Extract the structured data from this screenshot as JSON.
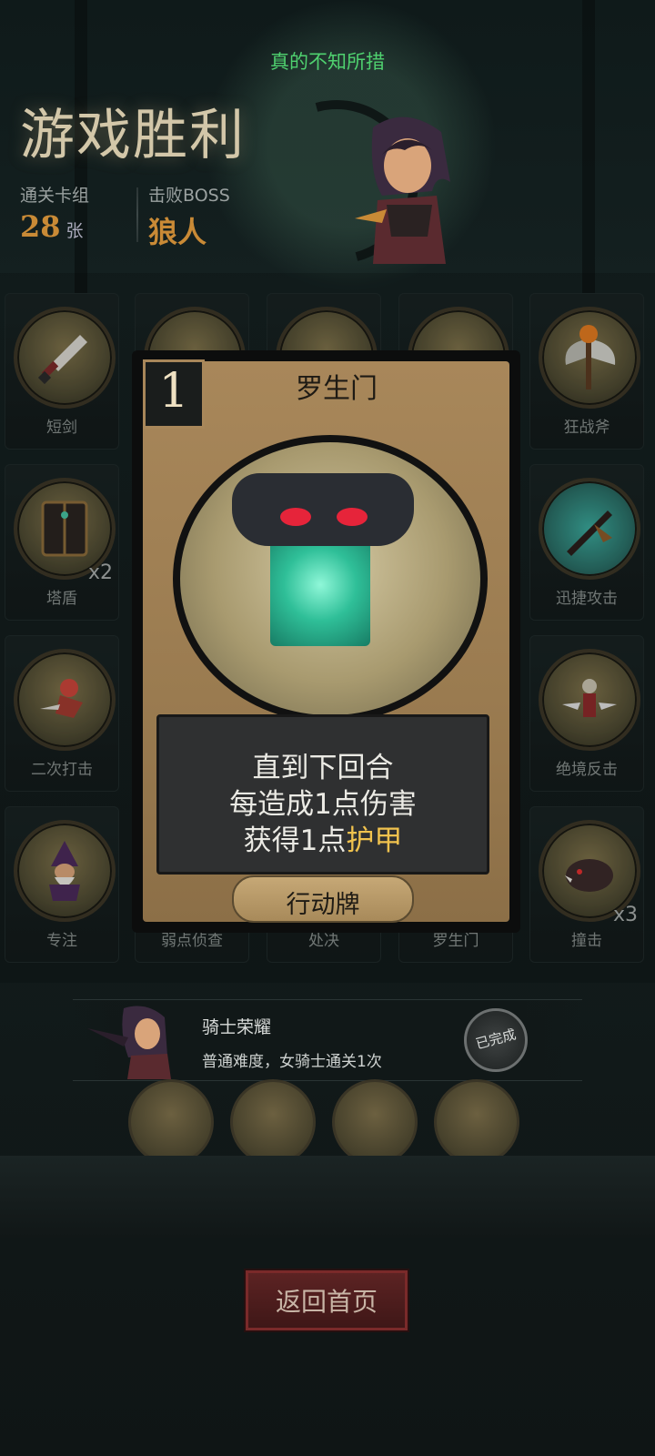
{
  "header": {
    "subtitle": "真的不知所措",
    "title": "游戏胜利"
  },
  "stats": {
    "deck_label": "通关卡组",
    "deck_count": "28",
    "deck_unit": "张",
    "boss_label": "击败BOSS",
    "boss_name": "狼人"
  },
  "cards": [
    {
      "label": "短剑",
      "count": "",
      "icon": "dagger-icon"
    },
    {
      "label": "",
      "count": "",
      "icon": "arrow-icon"
    },
    {
      "label": "",
      "count": "",
      "icon": "shield-round-icon"
    },
    {
      "label": "",
      "count": "",
      "icon": "battle-axe-icon"
    },
    {
      "label": "狂战斧",
      "count": "",
      "icon": "axe-icon"
    },
    {
      "label": "塔盾",
      "count": "x2",
      "icon": "tower-shield-icon"
    },
    {
      "label": "迅捷攻击",
      "count": "",
      "icon": "swift-strike-icon"
    },
    {
      "label": "二次打击",
      "count": "",
      "icon": "double-strike-icon"
    },
    {
      "label": "绝境反击",
      "count": "",
      "icon": "counter-attack-icon"
    },
    {
      "label": "专注",
      "count": "",
      "icon": "wizard-icon"
    },
    {
      "label": "弱点侦查",
      "count": "",
      "icon": "weakness-scout-icon"
    },
    {
      "label": "处决",
      "count": "",
      "icon": "execute-icon"
    },
    {
      "label": "罗生门",
      "count": "",
      "icon": "gate-icon"
    },
    {
      "label": "撞击",
      "count": "x3",
      "icon": "boar-icon"
    }
  ],
  "detail_card": {
    "cost": "1",
    "name": "罗生门",
    "effect_line1": "直到下回合",
    "effect_line2": "每造成1点伤害",
    "effect_line3_prefix": "获得1点",
    "effect_line3_highlight": "护甲",
    "type": "行动牌"
  },
  "achievement": {
    "title": "骑士荣耀",
    "description": "普通难度，女骑士通关1次",
    "status": "已完成"
  },
  "rewards": [
    "treasure-icon",
    "chest-icon",
    "cards-hand-icon",
    "demon-icon"
  ],
  "footer": {
    "home_button": "返回首页"
  },
  "colors": {
    "accent_gold": "#c98a36",
    "subtitle_green": "#4fd16f",
    "highlight_yellow": "#f0c24e",
    "button_red": "#5c2323"
  }
}
